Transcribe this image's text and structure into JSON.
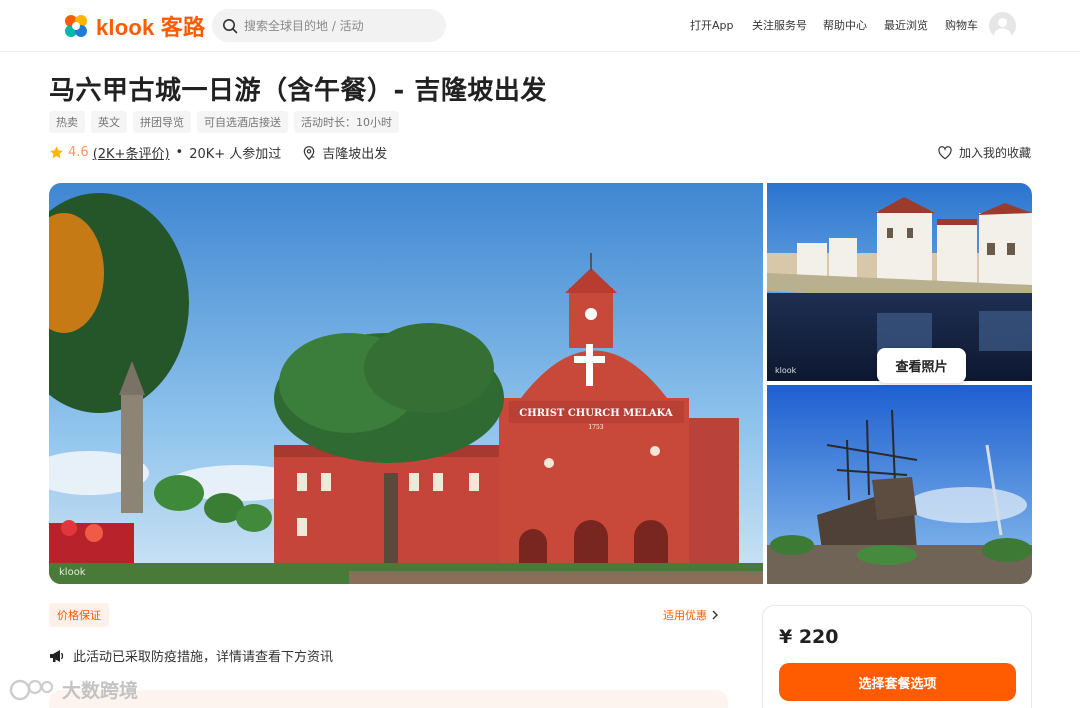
{
  "header": {
    "logo_text": "klook 客路",
    "search_placeholder": "搜索全球目的地 / 活动",
    "nav": [
      "打开App",
      "关注服务号",
      "帮助中心",
      "最近浏览",
      "购物车"
    ]
  },
  "activity": {
    "title": "马六甲古城一日游（含午餐）- 吉隆坡出发",
    "tags": [
      "热卖",
      "英文",
      "拼团导览",
      "可自选酒店接送",
      "活动时长：10小时"
    ],
    "rating": "4.6",
    "reviews": "(2K+条评价)",
    "separator": "•",
    "participants": "20K+ 人参加过",
    "departure": "吉隆坡出发",
    "favorite_label": "加入我的收藏"
  },
  "gallery": {
    "church_sign": "CHRIST CHURCH MELAKA",
    "church_year": "1753",
    "photo_watermark": "klook",
    "view_photos_label": "查看照片"
  },
  "booking": {
    "guarantee_badge": "价格保证",
    "promo_link": "适用优惠",
    "notice": "此活动已采取防疫措施，详情请查看下方资讯",
    "price": "¥ 220",
    "cta": "选择套餐选项"
  },
  "watermark": {
    "text": "大数跨境"
  },
  "colors": {
    "brand": "#ff5b00",
    "star": "#ffb400",
    "church": "#c8483a",
    "sky": "#5a9fd8"
  }
}
